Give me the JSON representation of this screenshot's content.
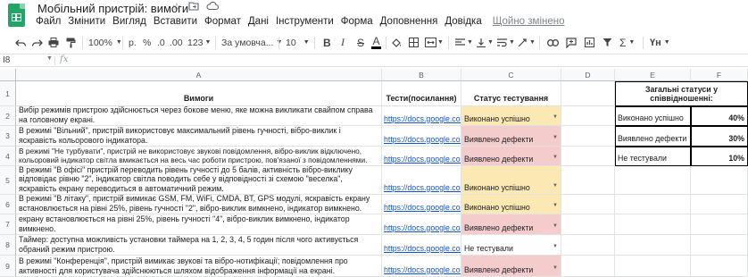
{
  "app": {
    "title": "Мобільний пристрій: вимоги",
    "saved_status": "Щойно змінено"
  },
  "menu": [
    "Файл",
    "Змінити",
    "Вигляд",
    "Вставити",
    "Формат",
    "Дані",
    "Інструменти",
    "Форма",
    "Доповнення",
    "Довідка"
  ],
  "toolbar": {
    "zoom": "100%",
    "currency": "р.",
    "percent": "%",
    "decimal_dec": ".0",
    "decimal_inc": ".00",
    "number_format": "123",
    "font": "За умовча...",
    "font_size": "10",
    "bold": "B",
    "italic": "I",
    "strike": "S",
    "text_color": "A"
  },
  "formula_bar": {
    "name_box": "I8",
    "fx": "fx"
  },
  "columns": [
    "A",
    "B",
    "C",
    "D",
    "E",
    "F"
  ],
  "rows": [
    "1",
    "2",
    "3",
    "4",
    "5",
    "6",
    "7",
    "8",
    "9"
  ],
  "headers": {
    "requirements": "Вимоги",
    "tests": "Тести(посилання)",
    "status": "Статус тестування",
    "summary": "Загальні статуси у співвідношенні:"
  },
  "requirements": [
    "Вибір режимів пристрою здійснюється через бокове меню, яке можна викликати свайпом справа на головному екрані.",
    "В режимі \"Вільний\", пристрій використовує максимальний рівень гучності, вібро-виклик і яскравість кольорового індикатора.",
    "В режимі \"Не турбувати\", пристрій не використовує звукові повідомлення, вібро-виклик відключено, кольоровий індикатор світла вмикається на весь час роботи пристрою, пов'язаної з повідомленнями.",
    "В режимі \"В офісі\" пристрій переводить рівень гучності до 5 балів, активність вібро-виклику відповідає рівню \"2\", індикатор світла поводить себе у відповідності зі схемою \"веселка\", яскравість екрану переводиться в автоматичний режим.",
    "В режимі \"В літаку\", пристрій вимикає GSM, FM, WiFi, CMDA, BT, GPS модулі, яскравість екрану встановлюється на рівні 25%, рівень гучності \"2\", вібро-виклик вимкнено, індикатор вимкнено.",
    "В режимі \"Енергозберігаючий\", пристрій вимикає FM, WiFi, CMDA, BT, GPS модулі, яскравість екрану встановлюється на рівні 25%, рівень гучності \"4\", вібро-виклик вимкнено, індикатор вимкнено.",
    "Таймер: доступна можливість установки таймера на 1, 2, 3, 4, 5 годин після чого активується обраний режим пристрою.",
    "В режимі \"Конференція\", пристрій вимикає звукові та вібро-нотифікації; повідомлення про активності для користувача здійснюються шляхом відображення інформації на екрані."
  ],
  "tests": [
    "https://docs.google.com",
    "https://docs.google.com",
    "https://docs.google.com",
    "https://docs.google.com",
    "https://docs.google.com",
    "https://docs.google.com",
    "https://docs.google.com",
    "https://docs.google.com"
  ],
  "statuses": [
    "Виконано успішно",
    "Виявлено дефекти",
    "Виявлено дефекти",
    "Виконано успішно",
    "Виконано успішно",
    "Виявлено дефекти",
    "Не тестували",
    "Виявлено дефекти"
  ],
  "summary": [
    {
      "label": "Виконано успішно",
      "value": "40%"
    },
    {
      "label": "Виявлено дефекти",
      "value": "30%"
    },
    {
      "label": "Не тестували",
      "value": "10%"
    }
  ],
  "colors": {
    "passed": "#fce8b2",
    "defects": "#f4cccc",
    "link": "#1155cc",
    "brand": "#23a566"
  }
}
